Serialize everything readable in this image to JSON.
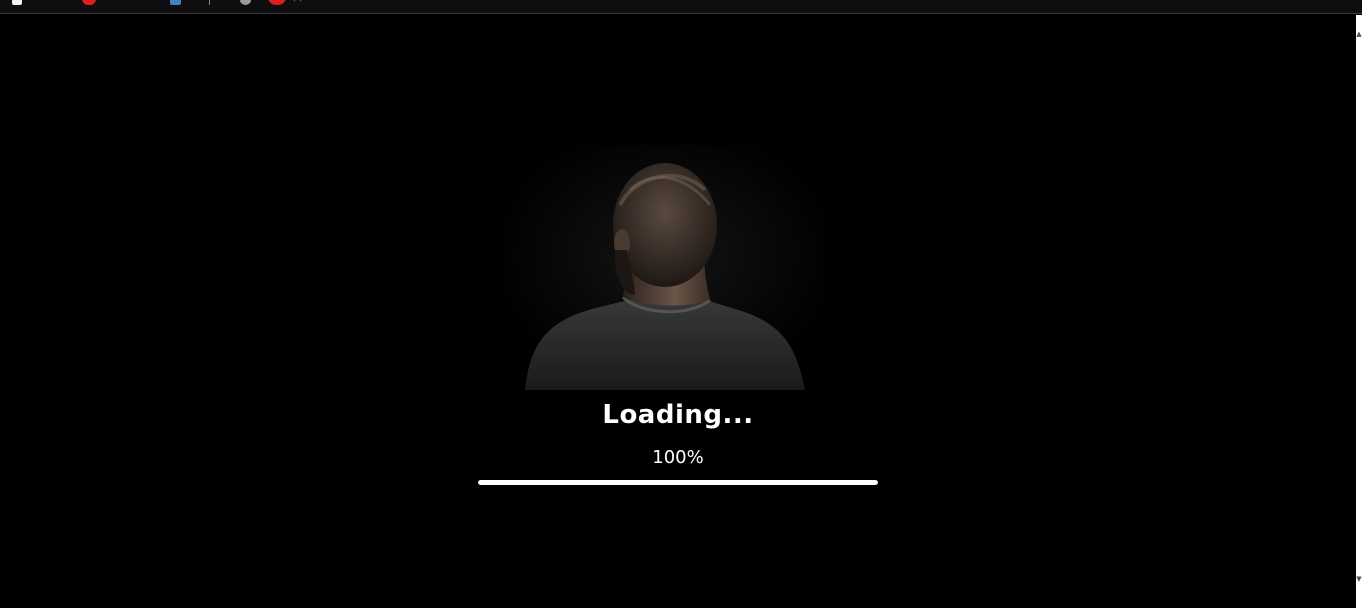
{
  "bookmarks_bar": {
    "items": [
      {
        "icon": "document-icon"
      },
      {
        "icon": "youtube-icon"
      },
      {
        "icon": "user-icon"
      },
      {
        "icon": "google-icon"
      },
      {
        "icon": "youtube-icon"
      }
    ],
    "trailing_text": "(  )"
  },
  "loader": {
    "label": "Loading...",
    "percent_text": "100%",
    "progress": 1.0,
    "colors": {
      "background": "#000000",
      "text": "#ffffff",
      "bar_fill": "#ffffff"
    }
  }
}
